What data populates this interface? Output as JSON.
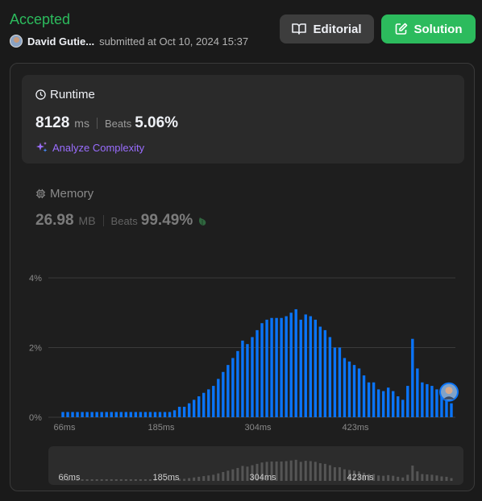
{
  "header": {
    "status": "Accepted",
    "username": "David Gutie...",
    "submitted_text": "submitted at Oct 10, 2024 15:37"
  },
  "buttons": {
    "editorial": "Editorial",
    "solution": "Solution"
  },
  "runtime": {
    "title": "Runtime",
    "value": "8128",
    "unit": "ms",
    "beats_label": "Beats",
    "beats_value": "5.06%",
    "analyze_label": "Analyze Complexity"
  },
  "memory": {
    "title": "Memory",
    "value": "26.98",
    "unit": "MB",
    "beats_label": "Beats",
    "beats_value": "99.49%"
  },
  "colors": {
    "accent_green": "#2cbb5d",
    "bar_blue": "#0a74f8",
    "analyze_purple": "#9a6dff"
  },
  "chart_data": {
    "type": "bar",
    "y_ticks": [
      "4%",
      "2%",
      "0%"
    ],
    "ylim": [
      0,
      4
    ],
    "x_ticks": [
      "66ms",
      "185ms",
      "304ms",
      "423ms"
    ],
    "overview_x_ticks": [
      "66ms",
      "185ms",
      "304ms",
      "423ms"
    ],
    "values": [
      0.15,
      0.15,
      0.15,
      0.15,
      0.15,
      0.15,
      0.15,
      0.15,
      0.15,
      0.15,
      0.15,
      0.15,
      0.15,
      0.15,
      0.15,
      0.15,
      0.15,
      0.15,
      0.15,
      0.15,
      0.15,
      0.15,
      0.15,
      0.2,
      0.3,
      0.3,
      0.4,
      0.5,
      0.6,
      0.7,
      0.8,
      0.9,
      1.1,
      1.3,
      1.5,
      1.7,
      1.9,
      2.2,
      2.1,
      2.3,
      2.5,
      2.7,
      2.8,
      2.85,
      2.85,
      2.85,
      2.9,
      3.0,
      3.1,
      2.8,
      2.95,
      2.9,
      2.8,
      2.6,
      2.5,
      2.3,
      2.0,
      2.0,
      1.7,
      1.6,
      1.5,
      1.4,
      1.2,
      1.0,
      1.0,
      0.8,
      0.75,
      0.85,
      0.75,
      0.6,
      0.5,
      0.9,
      2.25,
      1.4,
      1.0,
      0.95,
      0.9,
      0.8,
      0.65,
      0.6,
      0.4
    ],
    "highlight_index": 80
  }
}
